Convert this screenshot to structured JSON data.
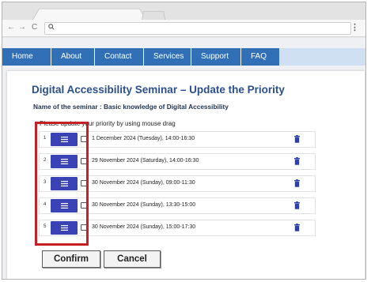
{
  "browser": {
    "back_glyph": "←",
    "forward_glyph": "→",
    "reload_glyph": "C",
    "menu_glyph": "⋮",
    "search_icon": "search-icon"
  },
  "site_nav": {
    "items": [
      {
        "label": "Home"
      },
      {
        "label": "About"
      },
      {
        "label": "Contact"
      },
      {
        "label": "Services"
      },
      {
        "label": "Support"
      },
      {
        "label": "FAQ"
      }
    ],
    "color": "#3170b7"
  },
  "page": {
    "title": "Digital Accessibility Seminar – Update the Priority",
    "seminar_name": "Name of the seminar : Basic knowledge of Digital Accessibility",
    "instruction": "Please update your priority by using mouse drag",
    "title_color": "#2a4f8e"
  },
  "priority_list": {
    "rows": [
      {
        "number": "1",
        "date": "1 December 2024 (Tuesday), 14:00-16:30"
      },
      {
        "number": "2",
        "date": "29 November 2024 (Saturday), 14:00-16:30"
      },
      {
        "number": "3",
        "date": "30 November 2024 (Sunday), 09:00-11:30"
      },
      {
        "number": "4",
        "date": "30 November 2024 (Sunday), 13:30-15:00"
      },
      {
        "number": "5",
        "date": "30 November 2024 (Sunday), 15:00-17:30"
      }
    ],
    "drag_handle_color": "#3a43b5",
    "trash_color": "#2c3fb0",
    "highlight_color": "#c42025"
  },
  "actions": {
    "confirm_label": "Confirm",
    "cancel_label": "Cancel"
  }
}
